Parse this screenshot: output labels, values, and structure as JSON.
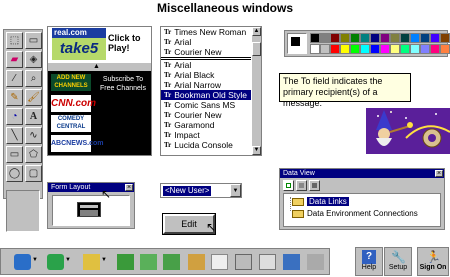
{
  "page_title": "Miscellaneous windows",
  "ad_panel": {
    "logo_line1": "real.com",
    "logo_line2": "take5",
    "cta": "Click to Play!",
    "channel_badge": "ADD NEW CHANNELS",
    "subscribe_text": "Subscribe To Free Channels",
    "channels": [
      "CNN.com",
      "COMEDY CENTRAL",
      "ABCNEWS.com"
    ]
  },
  "font_list": {
    "top_items": [
      "Times New Roman",
      "Arial",
      "Courier New"
    ],
    "items": [
      "Arial",
      "Arial Black",
      "Arial Narrow",
      "Bookman Old Style",
      "Comic Sans MS",
      "Courier New",
      "Garamond",
      "Impact",
      "Lucida Console"
    ],
    "selected_index": 3,
    "tt_glyph": "Tr"
  },
  "tooltip": {
    "text": "The To field indicates the primary recipient(s) of a message."
  },
  "form_layout": {
    "title": "Form Layout",
    "close": "×"
  },
  "user_dropdown": {
    "value": "<New User>"
  },
  "edit_button": {
    "label": "Edit"
  },
  "data_view": {
    "title": "Data View",
    "close": "×",
    "items": [
      "Data Links",
      "Data Environment Connections"
    ]
  },
  "toolbar_buttons": {
    "help": "Help",
    "setup": "Setup",
    "signon": "Sign On"
  },
  "colors": {
    "palette": [
      "#000000",
      "#808080",
      "#800000",
      "#808000",
      "#008000",
      "#008080",
      "#000080",
      "#800080",
      "#808040",
      "#004040",
      "#0080ff",
      "#004080",
      "#4000ff",
      "#804000",
      "#ffffff",
      "#c0c0c0",
      "#ff0000",
      "#ffff00",
      "#00ff00",
      "#00ffff",
      "#0000ff",
      "#ff00ff",
      "#ffff80",
      "#00ff80",
      "#80ffff",
      "#8080ff",
      "#ff0080",
      "#ff8040"
    ]
  }
}
